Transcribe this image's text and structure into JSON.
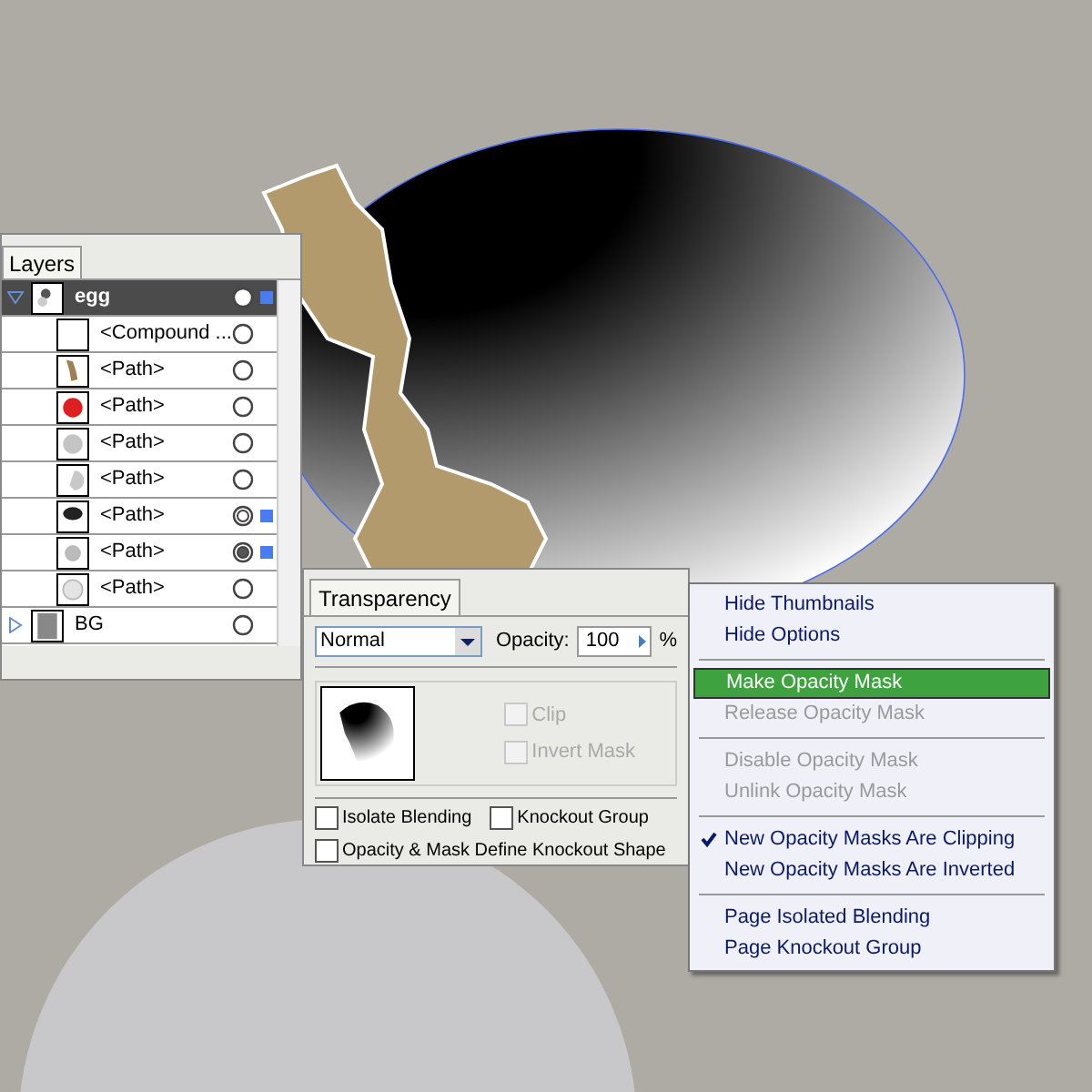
{
  "layers_panel": {
    "tab": "Layers",
    "layers": [
      {
        "name": "egg",
        "selected": true,
        "expanded": true,
        "has_appearance": false,
        "targeted": false,
        "marked": true,
        "children": [
          {
            "name": "<Compound ...",
            "selected": false,
            "has_appearance": false,
            "targeted": false,
            "marked": false
          },
          {
            "name": "<Path>",
            "selected": false,
            "has_appearance": false,
            "targeted": false,
            "marked": false
          },
          {
            "name": "<Path>",
            "selected": false,
            "has_appearance": false,
            "targeted": false,
            "marked": false
          },
          {
            "name": "<Path>",
            "selected": false,
            "has_appearance": false,
            "targeted": false,
            "marked": false
          },
          {
            "name": "<Path>",
            "selected": false,
            "has_appearance": false,
            "targeted": false,
            "marked": false
          },
          {
            "name": "<Path>",
            "selected": false,
            "has_appearance": true,
            "targeted": false,
            "marked": true
          },
          {
            "name": "<Path>",
            "selected": false,
            "has_appearance": true,
            "targeted": true,
            "marked": true
          },
          {
            "name": "<Path>",
            "selected": false,
            "has_appearance": false,
            "targeted": false,
            "marked": false
          }
        ]
      },
      {
        "name": "BG",
        "selected": false,
        "expanded": false,
        "has_appearance": false,
        "targeted": false,
        "marked": false
      }
    ]
  },
  "transparency_panel": {
    "tab": "Transparency",
    "blend_mode": "Normal",
    "opacity_label": "Opacity:",
    "opacity": "100",
    "percent": "%",
    "mask_options": [
      {
        "label": "Clip",
        "checked": false,
        "disabled": true
      },
      {
        "label": "Invert Mask",
        "checked": false,
        "disabled": true
      }
    ],
    "options": [
      {
        "label": "Isolate Blending",
        "checked": false
      },
      {
        "label": "Knockout Group",
        "checked": false
      },
      {
        "label": "Opacity & Mask Define Knockout Shape",
        "checked": false
      }
    ]
  },
  "menu": [
    {
      "kind": "item",
      "label": "Hide Thumbnails",
      "disabled": false,
      "selected": false,
      "checked": false
    },
    {
      "kind": "item",
      "label": "Hide Options",
      "disabled": false,
      "selected": false,
      "checked": false
    },
    {
      "kind": "separator"
    },
    {
      "kind": "item",
      "label": "Make Opacity Mask",
      "disabled": false,
      "selected": true,
      "checked": false
    },
    {
      "kind": "item",
      "label": "Release Opacity Mask",
      "disabled": true,
      "selected": false,
      "checked": false
    },
    {
      "kind": "separator"
    },
    {
      "kind": "item",
      "label": "Disable Opacity Mask",
      "disabled": true,
      "selected": false,
      "checked": false
    },
    {
      "kind": "item",
      "label": "Unlink Opacity Mask",
      "disabled": true,
      "selected": false,
      "checked": false
    },
    {
      "kind": "separator"
    },
    {
      "kind": "item",
      "label": "New Opacity Masks Are Clipping",
      "disabled": false,
      "selected": false,
      "checked": true
    },
    {
      "kind": "item",
      "label": "New Opacity Masks Are Inverted",
      "disabled": false,
      "selected": false,
      "checked": false
    },
    {
      "kind": "separator"
    },
    {
      "kind": "item",
      "label": "Page Isolated Blending",
      "disabled": false,
      "selected": false,
      "checked": false
    },
    {
      "kind": "item",
      "label": "Page Knockout Group",
      "disabled": false,
      "selected": false,
      "checked": false
    }
  ]
}
